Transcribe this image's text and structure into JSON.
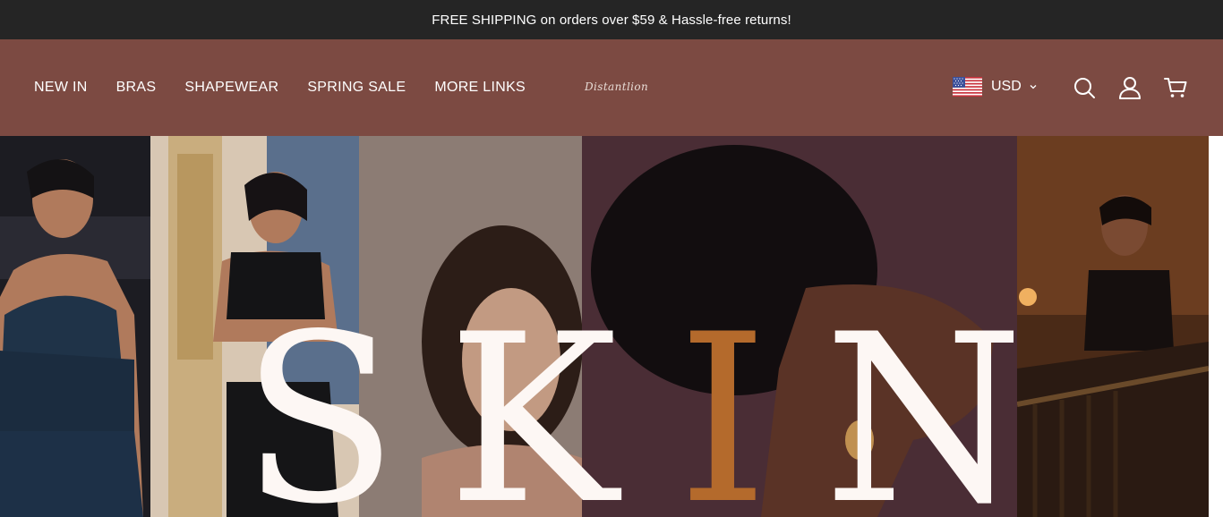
{
  "announcement": {
    "text": "FREE SHIPPING on orders over $59 & Hassle-free returns!"
  },
  "header": {
    "nav": [
      {
        "label": "NEW IN"
      },
      {
        "label": "BRAS"
      },
      {
        "label": "SHAPEWEAR"
      },
      {
        "label": "SPRING SALE"
      },
      {
        "label": "MORE LINKS"
      }
    ],
    "logo_text": "Distantlion",
    "currency": {
      "label": "USD",
      "flag_icon": "us-flag-icon",
      "chevron_icon": "chevron-down-icon"
    },
    "icons": {
      "search": "search-icon",
      "account": "user-icon",
      "cart": "cart-icon"
    }
  },
  "hero": {
    "letters": [
      "S",
      "K",
      "I",
      "N"
    ],
    "colors": {
      "letter_main": "#fdf7f4",
      "letter_accent": "#b46a2c",
      "header_bg": "#7c4a42",
      "announce_bg": "#252525"
    }
  }
}
